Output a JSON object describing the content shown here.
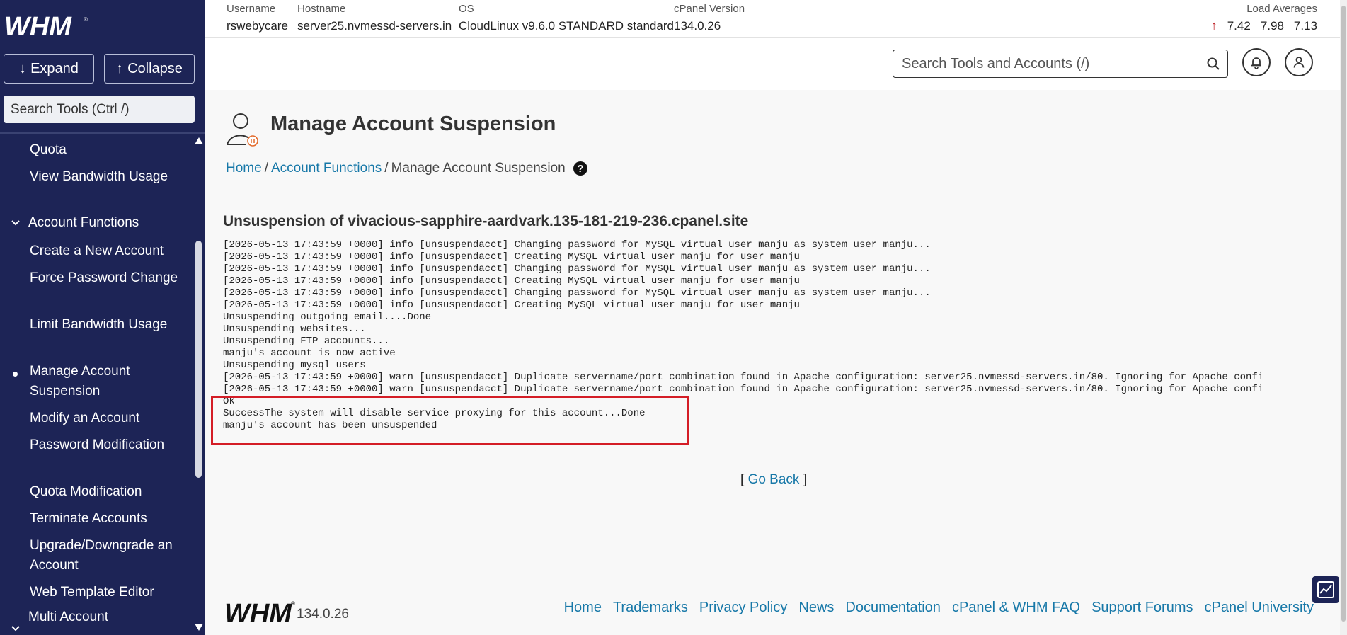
{
  "sidebar": {
    "logo": "WHM",
    "expand_label": "Expand",
    "collapse_label": "Collapse",
    "search_placeholder": "Search Tools (Ctrl /)",
    "items": [
      {
        "label": "Quota",
        "type": "item"
      },
      {
        "label": "View Bandwidth Usage",
        "type": "item"
      },
      {
        "label": "Account Functions",
        "type": "section"
      },
      {
        "label": "Create a New Account",
        "type": "item"
      },
      {
        "label": "Force Password Change",
        "type": "item"
      },
      {
        "label": "Limit Bandwidth Usage",
        "type": "item"
      },
      {
        "label": "Manage Account Suspension",
        "type": "item",
        "active": true
      },
      {
        "label": "Modify an Account",
        "type": "item"
      },
      {
        "label": "Password Modification",
        "type": "item"
      },
      {
        "label": "Quota Modification",
        "type": "item"
      },
      {
        "label": "Terminate Accounts",
        "type": "item"
      },
      {
        "label": "Upgrade/Downgrade an Account",
        "type": "item"
      },
      {
        "label": "Web Template Editor",
        "type": "item"
      },
      {
        "label": "Multi Account",
        "type": "section"
      }
    ]
  },
  "topbar": {
    "username_label": "Username",
    "username": "rswebycare",
    "hostname_label": "Hostname",
    "hostname": "server25.nvmessd-servers.in",
    "os_label": "OS",
    "os": "CloudLinux v9.6.0 STANDARD standard",
    "cpanel_label": "cPanel Version",
    "cpanel": "134.0.26",
    "load_label": "Load Averages",
    "load1": "7.42",
    "load5": "7.98",
    "load15": "7.13"
  },
  "header": {
    "search_placeholder": "Search Tools and Accounts (/)"
  },
  "page": {
    "title": "Manage Account Suspension",
    "breadcrumb": {
      "home": "Home",
      "section": "Account Functions",
      "current": "Manage Account Suspension"
    },
    "subtitle": "Unsuspension of vivacious-sapphire-aardvark.135-181-219-236.cpanel.site",
    "log": "[2026-05-13 17:43:59 +0000] info [unsuspendacct] Changing password for MySQL virtual user manju as system user manju...\n[2026-05-13 17:43:59 +0000] info [unsuspendacct] Creating MySQL virtual user manju for user manju\n[2026-05-13 17:43:59 +0000] info [unsuspendacct] Changing password for MySQL virtual user manju as system user manju...\n[2026-05-13 17:43:59 +0000] info [unsuspendacct] Creating MySQL virtual user manju for user manju\n[2026-05-13 17:43:59 +0000] info [unsuspendacct] Changing password for MySQL virtual user manju as system user manju...\n[2026-05-13 17:43:59 +0000] info [unsuspendacct] Creating MySQL virtual user manju for user manju\nUnsuspending outgoing email....Done\nUnsuspending websites...\nUnsuspending FTP accounts...\nmanju's account is now active\nUnsuspending mysql users\n[2026-05-13 17:43:59 +0000] warn [unsuspendacct] Duplicate servername/port combination found in Apache configuration: server25.nvmessd-servers.in/80. Ignoring for Apache confi\n[2026-05-13 17:43:59 +0000] warn [unsuspendacct] Duplicate servername/port combination found in Apache configuration: server25.nvmessd-servers.in/80. Ignoring for Apache confi\nOk\nSuccessThe system will disable service proxying for this account...Done\nmanju's account has been unsuspended",
    "goback_open": "[",
    "goback_label": "Go Back",
    "goback_close": "]"
  },
  "footer": {
    "logo": "WHM",
    "version": "134.0.26",
    "links": [
      "Home",
      "Trademarks",
      "Privacy Policy",
      "News",
      "Documentation",
      "cPanel & WHM FAQ",
      "Support Forums",
      "cPanel University"
    ]
  }
}
